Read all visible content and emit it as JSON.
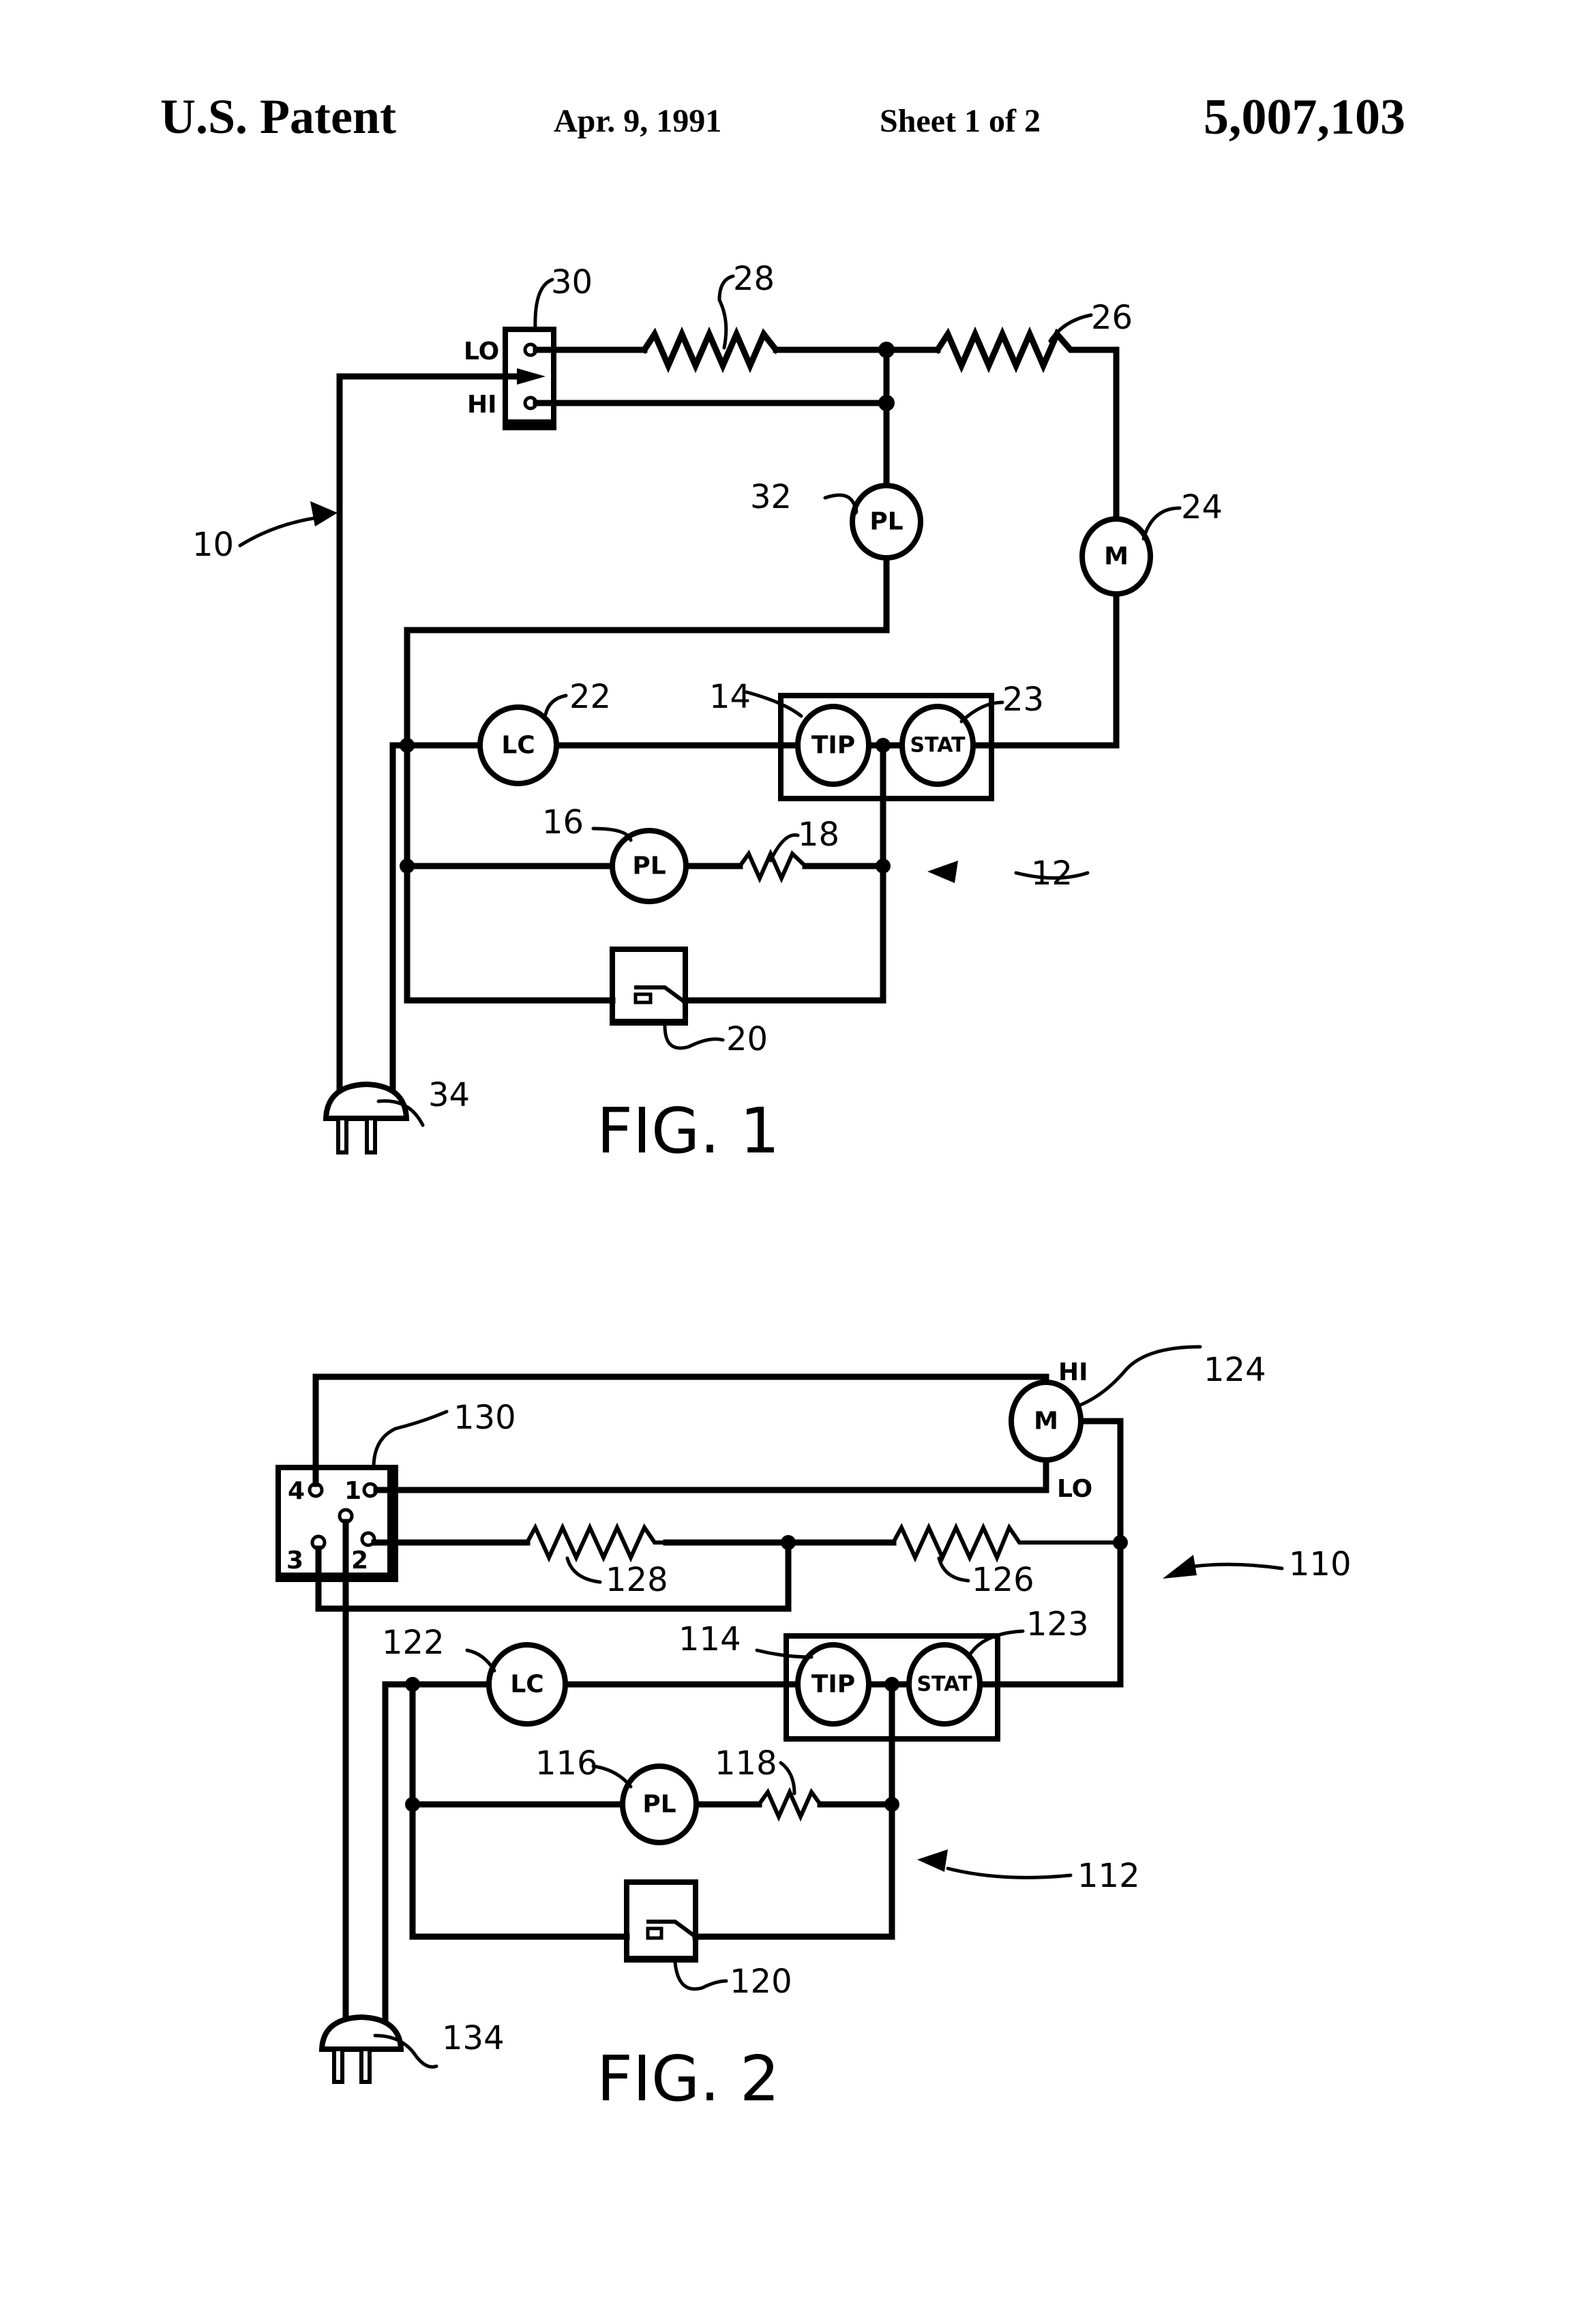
{
  "header": {
    "left": "U.S. Patent",
    "date": "Apr. 9, 1991",
    "sheet": "Sheet 1 of 2",
    "patent_number": "5,007,103"
  },
  "fig1": {
    "caption": "FIG. 1",
    "refs": {
      "circuit": "10",
      "subcircuit": "12",
      "tip": "14",
      "pilot_light_lower": "16",
      "resistor_lower": "18",
      "thermal_switch": "20",
      "light_control": "22",
      "thermostat": "23",
      "motor": "24",
      "resistor_right": "26",
      "resistor_left": "28",
      "selector_switch": "30",
      "pilot_light_upper": "32",
      "plug": "34"
    },
    "component_text": {
      "switch_lo": "LO",
      "switch_hi": "HI",
      "pl": "PL",
      "m": "M",
      "lc": "LC",
      "tip": "TIP",
      "stat": "STAT"
    }
  },
  "fig2": {
    "caption": "FIG. 2",
    "refs": {
      "circuit": "110",
      "subcircuit": "112",
      "tip": "114",
      "pilot_light": "116",
      "resistor_lower": "118",
      "thermal_switch": "120",
      "light_control": "122",
      "thermostat": "123",
      "motor": "124",
      "resistor_right": "126",
      "resistor_left": "128",
      "selector_switch": "130",
      "plug": "134"
    },
    "component_text": {
      "motor_hi": "HI",
      "motor_lo": "LO",
      "m": "M",
      "lc": "LC",
      "tip": "TIP",
      "stat": "STAT",
      "pl": "PL",
      "terminal_1": "1",
      "terminal_2": "2",
      "terminal_3": "3",
      "terminal_4": "4"
    }
  }
}
